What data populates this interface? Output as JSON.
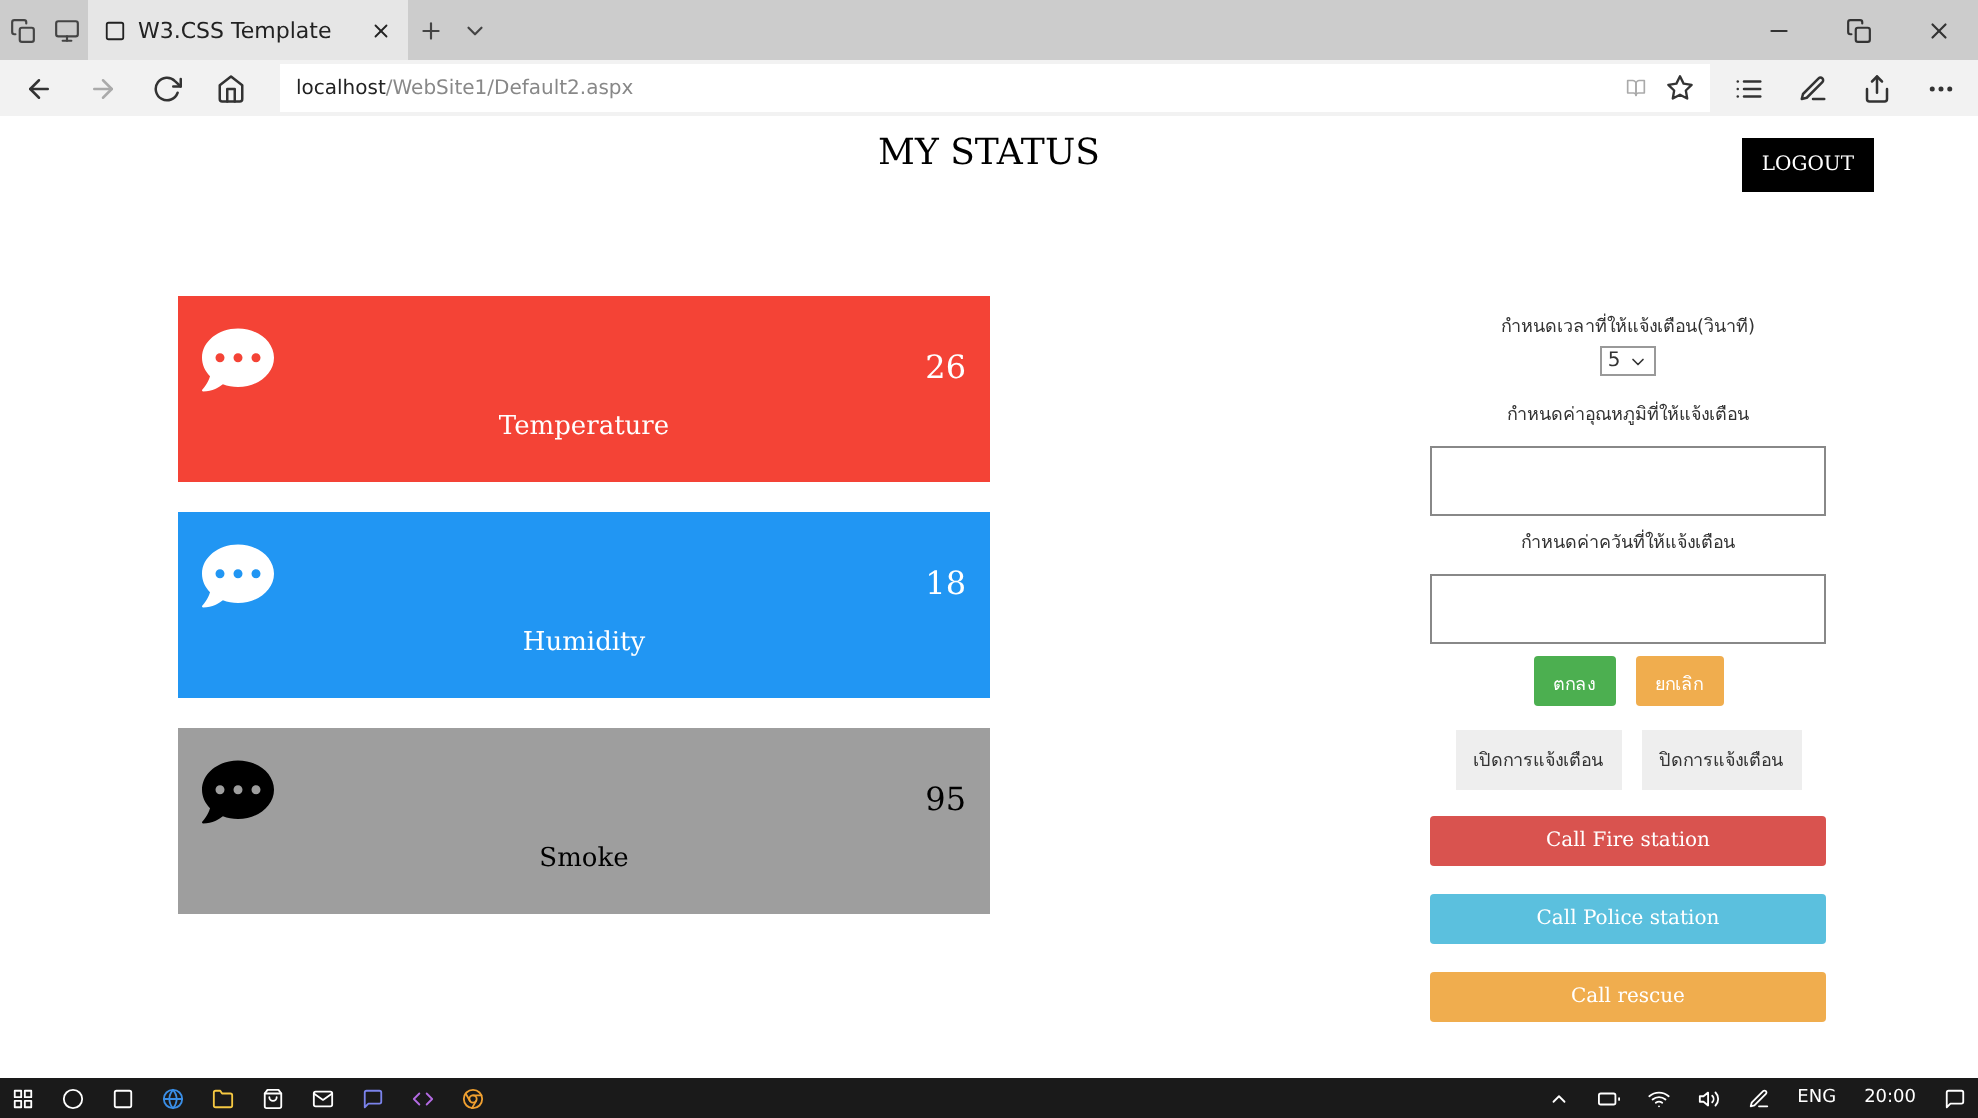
{
  "browser": {
    "tab_title": "W3.CSS Template",
    "url_host": "localhost",
    "url_path": "/WebSite1/Default2.aspx"
  },
  "header": {
    "title": "MY STATUS",
    "logout": "LOGOUT"
  },
  "cards": [
    {
      "label": "Temperature",
      "value": "26",
      "color": "#f44336"
    },
    {
      "label": "Humidity",
      "value": "18",
      "color": "#2196f3"
    },
    {
      "label": "Smoke",
      "value": "95",
      "color": "#9e9e9e"
    }
  ],
  "settings": {
    "interval_label": "กำหนดเวลาที่ให้แจ้งเตือน(วินาที)",
    "interval_value": "5",
    "temperature_label": "กำหนดค่าอุณหภูมิที่ให้แจ้งเตือน",
    "smoke_label": "กำหนดค่าควันที่ให้แจ้งเตือน",
    "actions": [
      {
        "label": "ตกลง",
        "color": "#4caf50"
      },
      {
        "label": "ยกเลิก",
        "color": "#f0ad4e"
      }
    ],
    "toggles": [
      "เปิดการแจ้งเตือน",
      "ปิดการแจ้งเตือน"
    ]
  },
  "calls": [
    {
      "label": "Call Fire station",
      "color": "#d9534f"
    },
    {
      "label": "Call Police station",
      "color": "#5bc0de"
    },
    {
      "label": "Call rescue",
      "color": "#f0ad4e"
    }
  ],
  "taskbar": {
    "language": "ENG",
    "time": "20:00"
  }
}
